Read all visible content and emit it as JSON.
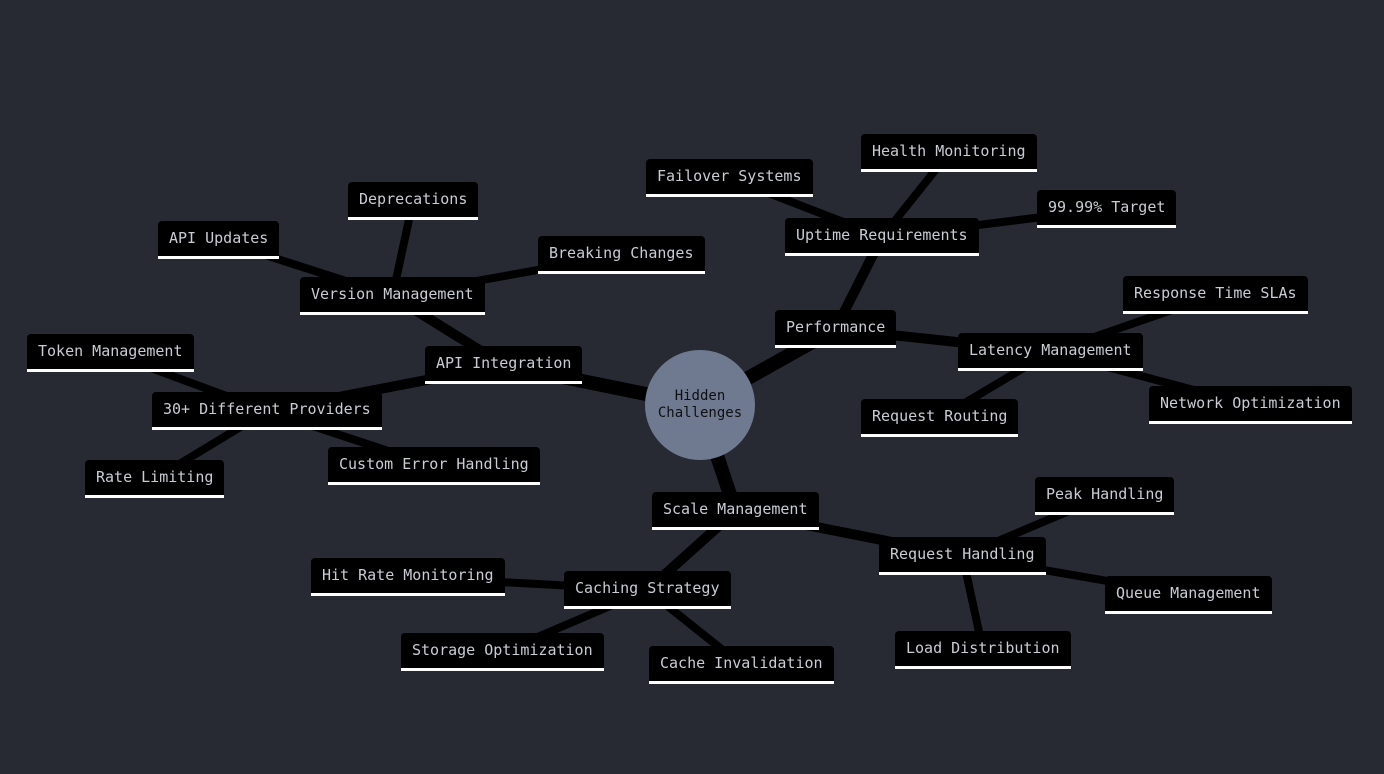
{
  "diagram": {
    "type": "mindmap",
    "colors": {
      "background": "#272a33",
      "node_fill": "#000000",
      "node_text": "#c9ccd3",
      "node_underline": "#ffffff",
      "root_fill": "#6f7a91",
      "root_text": "#0e0f12",
      "edge": "#000000"
    },
    "root": {
      "id": "root",
      "label": "Hidden\nChallenges"
    },
    "nodes": [
      {
        "id": "api",
        "label": "API Integration",
        "parent": "root"
      },
      {
        "id": "version",
        "label": "Version Management",
        "parent": "api"
      },
      {
        "id": "api_updates",
        "label": "API Updates",
        "parent": "version"
      },
      {
        "id": "deprecations",
        "label": "Deprecations",
        "parent": "version"
      },
      {
        "id": "breaking",
        "label": "Breaking Changes",
        "parent": "version"
      },
      {
        "id": "providers",
        "label": "30+ Different Providers",
        "parent": "api"
      },
      {
        "id": "token",
        "label": "Token Management",
        "parent": "providers"
      },
      {
        "id": "rate",
        "label": "Rate Limiting",
        "parent": "providers"
      },
      {
        "id": "custom_err",
        "label": "Custom Error Handling",
        "parent": "providers"
      },
      {
        "id": "perf",
        "label": "Performance",
        "parent": "root"
      },
      {
        "id": "uptime",
        "label": "Uptime Requirements",
        "parent": "perf"
      },
      {
        "id": "failover",
        "label": "Failover Systems",
        "parent": "uptime"
      },
      {
        "id": "health",
        "label": "Health Monitoring",
        "parent": "uptime"
      },
      {
        "id": "target",
        "label": "99.99% Target",
        "parent": "uptime"
      },
      {
        "id": "latency",
        "label": "Latency Management",
        "parent": "perf"
      },
      {
        "id": "sla",
        "label": "Response Time SLAs",
        "parent": "latency"
      },
      {
        "id": "routing",
        "label": "Request Routing",
        "parent": "latency"
      },
      {
        "id": "network",
        "label": "Network Optimization",
        "parent": "latency"
      },
      {
        "id": "scale",
        "label": "Scale Management",
        "parent": "root"
      },
      {
        "id": "caching",
        "label": "Caching Strategy",
        "parent": "scale"
      },
      {
        "id": "hitrate",
        "label": "Hit Rate Monitoring",
        "parent": "caching"
      },
      {
        "id": "storage",
        "label": "Storage Optimization",
        "parent": "caching"
      },
      {
        "id": "invalidation",
        "label": "Cache Invalidation",
        "parent": "caching"
      },
      {
        "id": "reqhandling",
        "label": "Request Handling",
        "parent": "scale"
      },
      {
        "id": "peak",
        "label": "Peak Handling",
        "parent": "reqhandling"
      },
      {
        "id": "queue",
        "label": "Queue Management",
        "parent": "reqhandling"
      },
      {
        "id": "load",
        "label": "Load Distribution",
        "parent": "reqhandling"
      }
    ]
  }
}
